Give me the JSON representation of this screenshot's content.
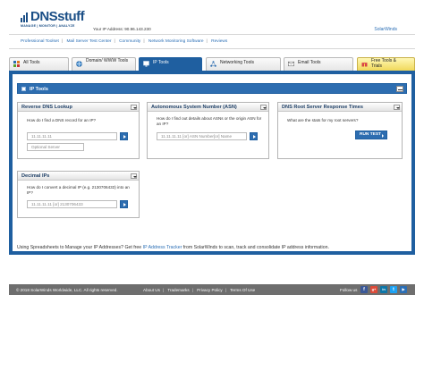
{
  "brand": {
    "name_dns": "DNS",
    "name_stuff": "stuff",
    "tagline": "MANAGE | MONITOR | ANALYZE",
    "ip_address_text": "Your IP Address: 90.96.143.230",
    "solarwinds_label": "SolarWinds"
  },
  "nav": {
    "links": [
      "Professional Toolset",
      "Mail Server Test Center",
      "Community",
      "Network Monitoring Software",
      "Reviews"
    ]
  },
  "tabs": [
    {
      "label": "All Tools",
      "icon": "grid-icon"
    },
    {
      "label": "Domain/ WWW Tools",
      "icon": "globe-icon"
    },
    {
      "label": "IP Tools",
      "icon": "monitor-icon"
    },
    {
      "label": "Networking Tools",
      "icon": "network-icon"
    },
    {
      "label": "Email Tools",
      "icon": "envelope-icon"
    },
    {
      "label": "Free Tools & Trials",
      "icon": "gift-icon"
    }
  ],
  "panel": {
    "title": "IP Tools"
  },
  "cards": {
    "reverse_dns": {
      "title": "Reverse DNS Lookup",
      "question": "How do I find a DNS record for an IP?",
      "input_placeholder": "11.11.11.11",
      "server_placeholder": "Optional Server"
    },
    "asn": {
      "title": "Autonomous System Number (ASN)",
      "question": "How do I find out details about ASNs or the origin ASN for an IP?",
      "input_placeholder": "11.11.11.11 [or] ASN Number[or] Name"
    },
    "root_server": {
      "title": "DNS Root Server Response Times",
      "question": "What are the stats for my root servers?",
      "button_label": "RUN TEST"
    },
    "decimal_ip": {
      "title": "Decimal IPs",
      "question": "How do I convert a decimal IP (e.g. 2130706433) into an IP?",
      "input_placeholder": "11.11.11.11 [or] 2130706433"
    }
  },
  "promo": {
    "before": "Using Spreadsheets to Manage your IP Addresses? Get free ",
    "link": "IP Address Tracker",
    "after": " from SolarWinds to scan, track and consolidate IP address information."
  },
  "footer": {
    "copyright": "© 2018 SolarWinds Worldwide, LLC. All rights reserved.",
    "links": [
      "About Us",
      "Trademarks",
      "Privacy Policy",
      "Terms Of Use"
    ],
    "follow_label": "Follow us",
    "social": [
      {
        "icon": "facebook-icon",
        "glyph": "f",
        "color": "#3b5998"
      },
      {
        "icon": "google-plus-icon",
        "glyph": "g+",
        "color": "#dd4b39"
      },
      {
        "icon": "linkedin-icon",
        "glyph": "in",
        "color": "#0e76a8"
      },
      {
        "icon": "twitter-icon",
        "glyph": "t",
        "color": "#1da1f2"
      },
      {
        "icon": "youtube-icon",
        "glyph": "▶",
        "color": "#2a6eb5"
      }
    ]
  },
  "colors": {
    "brand_blue": "#1a4e86",
    "panel_blue": "#1f5fa0",
    "link_blue": "#2a6eb5",
    "footer_gray": "#6e6e6e"
  }
}
